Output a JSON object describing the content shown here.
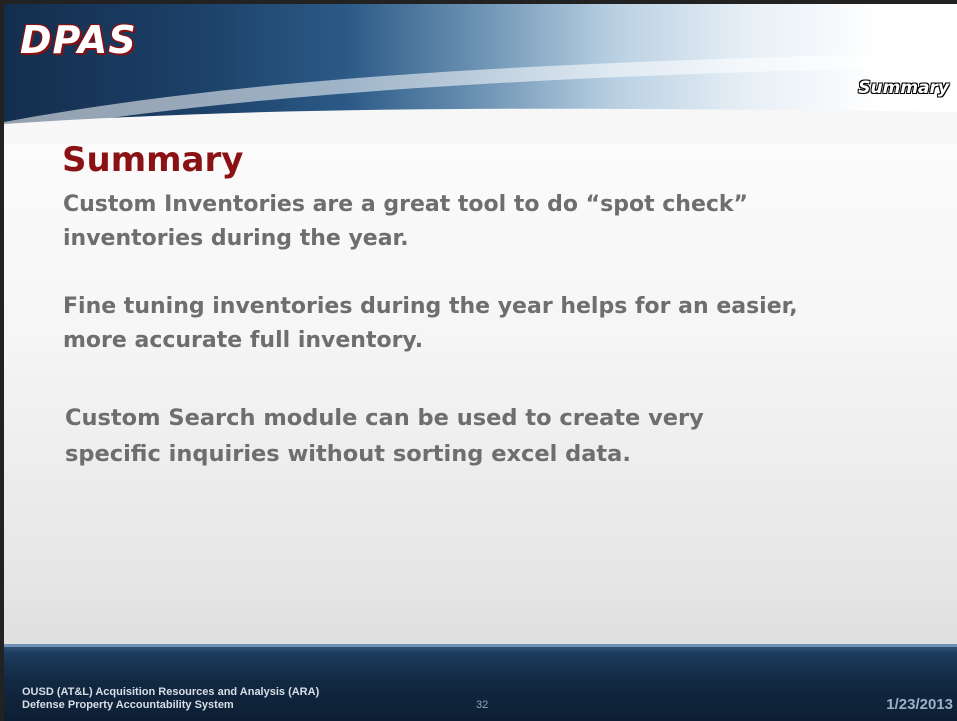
{
  "header": {
    "logo_text": "DPAS",
    "section_label": "Summary"
  },
  "slide": {
    "title": "Summary",
    "paragraphs": [
      "Custom Inventories are a great tool to do “spot check” inventories during the year.",
      "Fine tuning inventories during the year helps for an easier, more accurate full inventory.",
      "Custom Search module can be used to create very specific inquiries without sorting excel data."
    ]
  },
  "footer": {
    "org_line1": "OUSD (AT&L) Acquisition Resources and Analysis (ARA)",
    "org_line2": "Defense Property Accountability System",
    "page_number": "32",
    "date": "1/23/2013"
  },
  "colors": {
    "title": "#8b1214",
    "body_text": "#6e6e6e",
    "banner_dark": "#132e4d",
    "footer_dark": "#0c1e33",
    "logo_outline": "#8a0f12"
  }
}
